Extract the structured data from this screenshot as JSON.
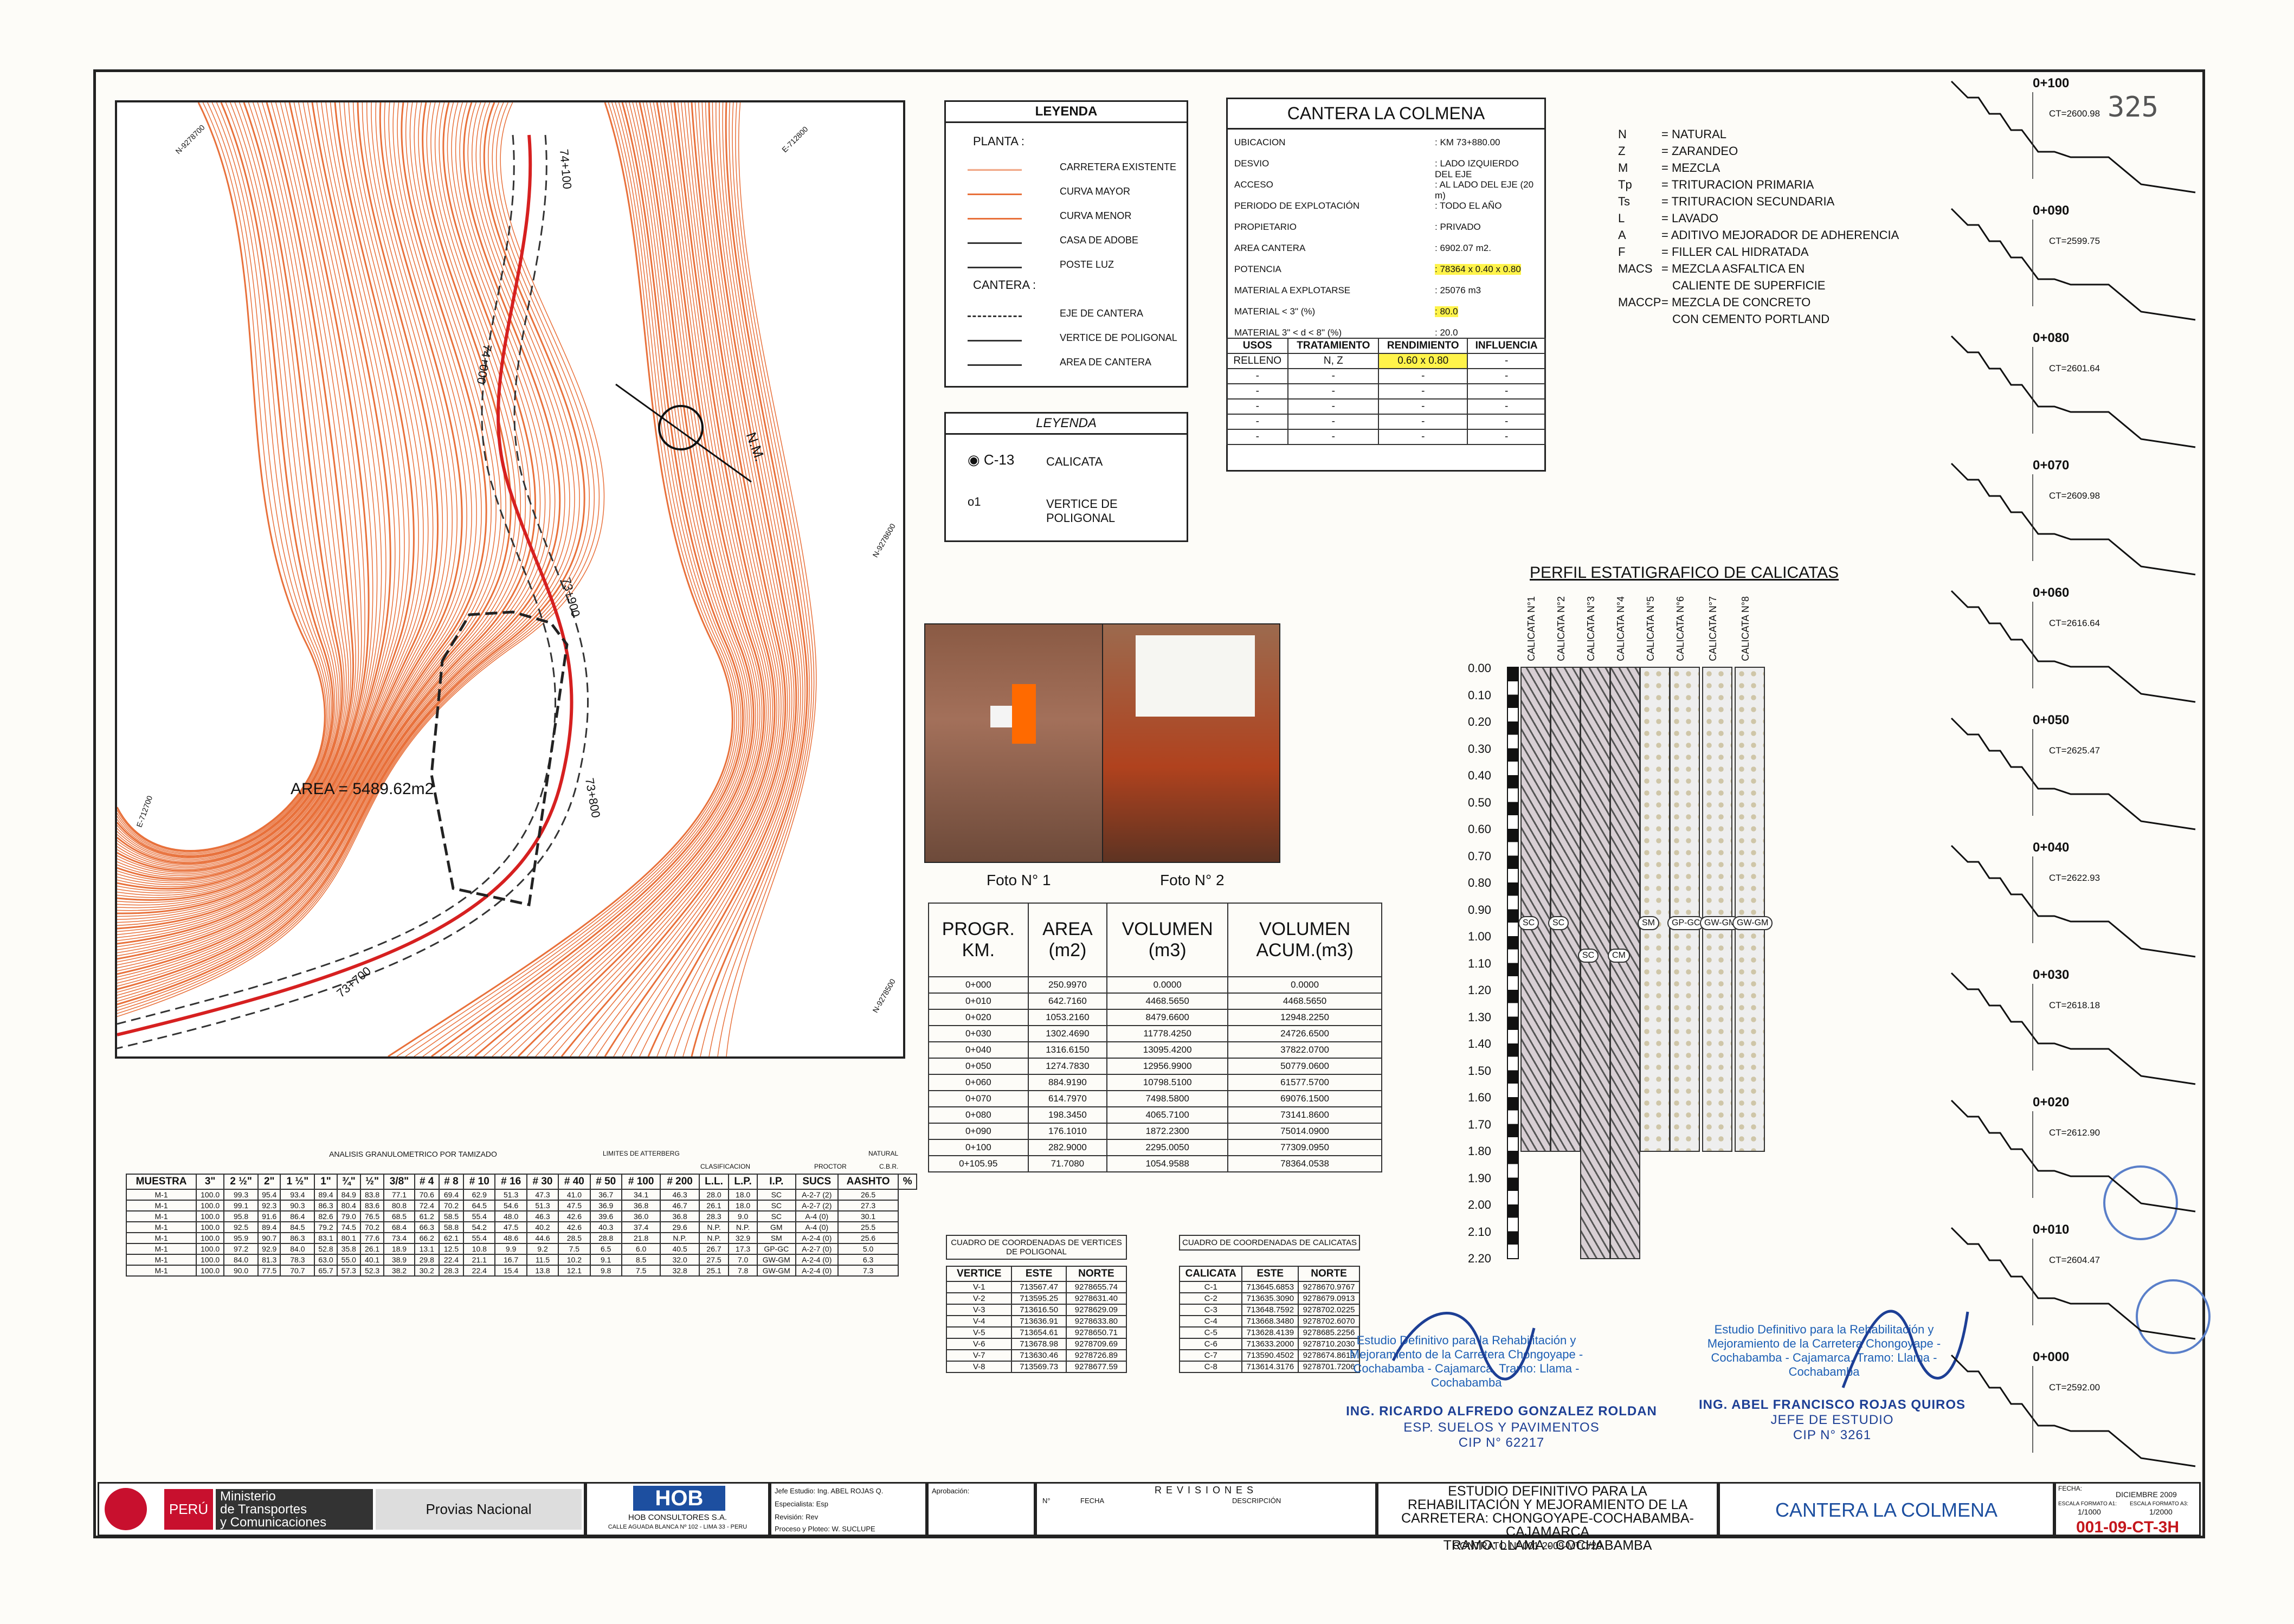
{
  "sheet": {
    "page_number": "325"
  },
  "map": {
    "area_label": "AREA = 5489.62m2",
    "north_label": "N.M.",
    "road_stations": [
      "74+100",
      "74+000",
      "73+900",
      "73+800",
      "73+700"
    ],
    "grid_labels": [
      "N-9278700",
      "E-712800",
      "N-9278600",
      "E-712700",
      "N-9278500"
    ]
  },
  "legend1": {
    "title": "LEYENDA",
    "planta_label": "PLANTA :",
    "cantera_label": "CANTERA :",
    "items": [
      {
        "label": "CARRETERA EXISTENTE",
        "icon": "road-line-icon"
      },
      {
        "label": "CURVA MAYOR",
        "icon": "major-contour-icon"
      },
      {
        "label": "CURVA MENOR",
        "icon": "minor-contour-icon"
      },
      {
        "label": "CASA DE ADOBE",
        "icon": "adobe-house-icon"
      },
      {
        "label": "POSTE LUZ",
        "icon": "light-pole-icon"
      },
      {
        "label": "EJE DE CANTERA",
        "icon": "quarry-axis-icon"
      },
      {
        "label": "VERTICE DE POLIGONAL",
        "icon": "polygon-vertex-icon"
      },
      {
        "label": "AREA DE CANTERA",
        "icon": "quarry-area-icon"
      }
    ]
  },
  "legend2": {
    "title": "LEYENDA",
    "items": [
      {
        "symbol": "C-13",
        "label": "CALICATA"
      },
      {
        "symbol": "o1",
        "label": "VERTICE DE POLIGONAL"
      }
    ]
  },
  "cantera": {
    "title": "CANTERA LA COLMENA",
    "rows": [
      {
        "k": "UBICACION",
        "v": ": KM 73+880.00",
        "hl": false
      },
      {
        "k": "DESVIO",
        "v": ": LADO IZQUIERDO DEL EJE",
        "hl": false
      },
      {
        "k": "ACCESO",
        "v": ": AL LADO DEL EJE (20 m)",
        "hl": false
      },
      {
        "k": "PERIODO DE EXPLOTACIÓN",
        "v": ": TODO EL AÑO",
        "hl": false
      },
      {
        "k": "PROPIETARIO",
        "v": ": PRIVADO",
        "hl": false
      },
      {
        "k": "AREA CANTERA",
        "v": ": 6902.07 m2.",
        "hl": false
      },
      {
        "k": "POTENCIA",
        "v": ": 78364 x 0.40 x 0.80",
        "hl": true
      },
      {
        "k": "MATERIAL A EXPLOTARSE",
        "v": ": 25076 m3",
        "hl": false
      },
      {
        "k": "MATERIAL < 3\" (%)",
        "v": ": 80.0",
        "hl": true
      },
      {
        "k": "MATERIAL 3\" < d < 8\" (%)",
        "v": ": 20.0",
        "hl": false
      }
    ],
    "uses_header": [
      "USOS",
      "TRATAMIENTO",
      "RENDIMIENTO",
      "INFLUENCIA"
    ],
    "uses_rows": [
      [
        "RELLENO",
        "N, Z",
        "0.60 x 0.80",
        "-"
      ],
      [
        "-",
        "-",
        "-",
        "-"
      ],
      [
        "-",
        "-",
        "-",
        "-"
      ],
      [
        "-",
        "-",
        "-",
        "-"
      ],
      [
        "-",
        "-",
        "-",
        "-"
      ],
      [
        "-",
        "-",
        "-",
        "-"
      ]
    ]
  },
  "abbreviations": [
    {
      "k": "N",
      "v": "= NATURAL"
    },
    {
      "k": "Z",
      "v": "= ZARANDEO"
    },
    {
      "k": "M",
      "v": "= MEZCLA"
    },
    {
      "k": "Tp",
      "v": "= TRITURACION PRIMARIA"
    },
    {
      "k": "Ts",
      "v": "= TRITURACION SECUNDARIA"
    },
    {
      "k": "L",
      "v": "= LAVADO"
    },
    {
      "k": "A",
      "v": "= ADITIVO MEJORADOR DE ADHERENCIA"
    },
    {
      "k": "F",
      "v": "= FILLER CAL HIDRATADA"
    },
    {
      "k": "MACS",
      "v": "= MEZCLA ASFALTICA EN"
    },
    {
      "k": "",
      "v": "CALIENTE DE SUPERFICIE"
    },
    {
      "k": "MACCP",
      "v": "= MEZCLA DE CONCRETO"
    },
    {
      "k": "",
      "v": "CON CEMENTO PORTLAND"
    }
  ],
  "photos": {
    "foto1": "Foto N° 1",
    "foto2": "Foto N° 2"
  },
  "volumes": {
    "header": [
      "PROGR. KM.",
      "AREA (m2)",
      "VOLUMEN (m3)",
      "VOLUMEN ACUM.(m3)"
    ],
    "rows": [
      [
        "0+000",
        "250.9970",
        "0.0000",
        "0.0000"
      ],
      [
        "0+010",
        "642.7160",
        "4468.5650",
        "4468.5650"
      ],
      [
        "0+020",
        "1053.2160",
        "8479.6600",
        "12948.2250"
      ],
      [
        "0+030",
        "1302.4690",
        "11778.4250",
        "24726.6500"
      ],
      [
        "0+040",
        "1316.6150",
        "13095.4200",
        "37822.0700"
      ],
      [
        "0+050",
        "1274.7830",
        "12956.9900",
        "50779.0600"
      ],
      [
        "0+060",
        "884.9190",
        "10798.5100",
        "61577.5700"
      ],
      [
        "0+070",
        "614.7970",
        "7498.5800",
        "69076.1500"
      ],
      [
        "0+080",
        "198.3450",
        "4065.7100",
        "73141.8600"
      ],
      [
        "0+090",
        "176.1010",
        "1872.2300",
        "75014.0900"
      ],
      [
        "0+100",
        "282.9000",
        "2295.0050",
        "77309.0950"
      ],
      [
        "0+105.95",
        "71.7080",
        "1054.9588",
        "78364.0538"
      ]
    ]
  },
  "profile": {
    "title": "PERFIL ESTATIGRAFICO DE CALICATAS",
    "calicatas": [
      "CALICATA N°1",
      "CALICATA N°2",
      "CALICATA N°3",
      "CALICATA N°4",
      "CALICATA N°5",
      "CALICATA N°6",
      "CALICATA N°7",
      "CALICATA N°8"
    ],
    "depths": [
      "0.00",
      "0.10",
      "0.20",
      "0.30",
      "0.40",
      "0.50",
      "0.60",
      "0.70",
      "0.80",
      "0.90",
      "1.00",
      "1.10",
      "1.20",
      "1.30",
      "1.40",
      "1.50",
      "1.60",
      "1.70",
      "1.80",
      "1.90",
      "2.00",
      "2.10",
      "2.20"
    ],
    "soil_tags": [
      "SC",
      "SC",
      "SC",
      "CM",
      "SM",
      "GP-GC",
      "GW-GM",
      "GW-GM"
    ]
  },
  "vertices": {
    "title": "CUADRO DE COORDENADAS DE VERTICES DE POLIGONAL",
    "header": [
      "VERTICE",
      "ESTE",
      "NORTE"
    ],
    "rows": [
      [
        "V-1",
        "713567.47",
        "9278655.74"
      ],
      [
        "V-2",
        "713595.25",
        "9278631.40"
      ],
      [
        "V-3",
        "713616.50",
        "9278629.09"
      ],
      [
        "V-4",
        "713636.91",
        "9278633.80"
      ],
      [
        "V-5",
        "713654.61",
        "9278650.71"
      ],
      [
        "V-6",
        "713678.98",
        "9278709.69"
      ],
      [
        "V-7",
        "713630.46",
        "9278726.89"
      ],
      [
        "V-8",
        "713569.73",
        "9278677.59"
      ]
    ]
  },
  "calicatas_coords": {
    "title": "CUADRO DE COORDENADAS DE CALICATAS",
    "header": [
      "CALICATA",
      "ESTE",
      "NORTE"
    ],
    "rows": [
      [
        "C-1",
        "713645.6853",
        "9278670.9767"
      ],
      [
        "C-2",
        "713635.3090",
        "9278679.0913"
      ],
      [
        "C-3",
        "713648.7592",
        "9278702.0225"
      ],
      [
        "C-4",
        "713668.3480",
        "9278702.6070"
      ],
      [
        "C-5",
        "713628.4139",
        "9278685.2256"
      ],
      [
        "C-6",
        "713633.2000",
        "9278710.2030"
      ],
      [
        "C-7",
        "713590.4502",
        "9278674.8619"
      ],
      [
        "C-8",
        "713614.3176",
        "9278701.7206"
      ]
    ]
  },
  "lab": {
    "title": "ANALISIS GRANULOMETRICO POR TAMIZADO",
    "limits": "LIMITES DE ATTERBERG",
    "classification": "CLASIFICACION",
    "natural": "NATURAL",
    "proctor": "PROCTOR",
    "cbr": "C.B.R.",
    "sieve_header": [
      "3\"",
      "2 ½\"",
      "2\"",
      "1 ½\"",
      "1\"",
      "¾\"",
      "½\"",
      "3/8\"",
      "# 4",
      "# 8",
      "# 10",
      "# 16",
      "# 30",
      "# 40",
      "# 50",
      "# 100",
      "# 200"
    ],
    "rows": [
      [
        "M-1",
        "100.0",
        "99.3",
        "95.4",
        "93.4",
        "89.4",
        "84.9",
        "83.8",
        "77.1",
        "70.6",
        "69.4",
        "62.9",
        "51.3",
        "47.3",
        "41.0",
        "36.7",
        "34.1",
        "46.3",
        "28.0",
        "18.0",
        "SC",
        "A-2-7 (2)",
        "26.5"
      ],
      [
        "M-1",
        "100.0",
        "99.1",
        "92.3",
        "90.3",
        "86.3",
        "80.4",
        "83.6",
        "80.8",
        "72.4",
        "70.2",
        "64.5",
        "54.6",
        "51.3",
        "47.5",
        "36.9",
        "36.8",
        "46.7",
        "26.1",
        "18.0",
        "SC",
        "A-2-7 (2)",
        "27.3"
      ],
      [
        "M-1",
        "100.0",
        "95.8",
        "91.6",
        "86.4",
        "82.6",
        "79.0",
        "76.5",
        "68.5",
        "61.2",
        "58.5",
        "55.4",
        "48.0",
        "46.3",
        "42.6",
        "39.6",
        "36.0",
        "36.8",
        "28.3",
        "9.0",
        "SC",
        "A-4 (0)",
        "30.1"
      ],
      [
        "M-1",
        "100.0",
        "92.5",
        "89.4",
        "84.5",
        "79.2",
        "74.5",
        "70.2",
        "68.4",
        "66.3",
        "58.8",
        "54.2",
        "47.5",
        "40.2",
        "42.6",
        "40.3",
        "37.4",
        "29.6",
        "N.P.",
        "N.P.",
        "GM",
        "A-4 (0)",
        "25.5"
      ],
      [
        "M-1",
        "100.0",
        "95.9",
        "90.7",
        "86.3",
        "83.1",
        "80.1",
        "77.6",
        "73.4",
        "66.2",
        "62.1",
        "55.4",
        "48.6",
        "44.6",
        "28.5",
        "28.8",
        "21.8",
        "N.P.",
        "N.P.",
        "32.9",
        "SM",
        "A-2-4 (0)",
        "25.6"
      ],
      [
        "M-1",
        "100.0",
        "97.2",
        "92.9",
        "84.0",
        "52.8",
        "35.8",
        "26.1",
        "18.9",
        "13.1",
        "12.5",
        "10.8",
        "9.9",
        "9.2",
        "7.5",
        "6.5",
        "6.0",
        "40.5",
        "26.7",
        "17.3",
        "GP-GC",
        "A-2-7 (0)",
        "5.0"
      ],
      [
        "M-1",
        "100.0",
        "84.0",
        "81.3",
        "78.3",
        "63.0",
        "55.0",
        "40.1",
        "38.9",
        "29.8",
        "22.4",
        "21.1",
        "16.7",
        "11.5",
        "10.2",
        "9.1",
        "8.5",
        "32.0",
        "27.5",
        "7.0",
        "GW-GM",
        "A-2-4 (0)",
        "6.3"
      ],
      [
        "M-1",
        "100.0",
        "90.0",
        "77.5",
        "70.7",
        "65.7",
        "57.3",
        "52.3",
        "38.2",
        "30.2",
        "28.3",
        "22.4",
        "15.4",
        "13.8",
        "12.1",
        "9.8",
        "7.5",
        "32.8",
        "25.1",
        "7.8",
        "GW-GM",
        "A-2-4 (0)",
        "7.3"
      ]
    ]
  },
  "signatures": {
    "left_note": "Estudio Definitivo para la Rehabilitación y Mejoramiento de la Carretera Chongoyape - Cochabamba - Cajamarca. Tramo: Llama - Cochabamba",
    "left_name": "ING. RICARDO ALFREDO GONZALEZ ROLDAN",
    "left_role": "ESP. SUELOS Y PAVIMENTOS",
    "left_cip": "CIP N° 62217",
    "right_note": "Estudio Definitivo para la Rehabilitación y Mejoramiento de la Carretera Chongoyape - Cochabamba - Cajamarca. Tramo: Llama - Cochabamba",
    "right_name": "ING. ABEL FRANCISCO ROJAS QUIROS",
    "right_role": "JEFE DE ESTUDIO",
    "right_cip": "CIP N° 3261"
  },
  "cross_sections": [
    {
      "station": "0+100",
      "ct": "CT=2600.98"
    },
    {
      "station": "0+090",
      "ct": "CT=2599.75"
    },
    {
      "station": "0+080",
      "ct": "CT=2601.64"
    },
    {
      "station": "0+070",
      "ct": "CT=2609.98"
    },
    {
      "station": "0+060",
      "ct": "CT=2616.64"
    },
    {
      "station": "0+050",
      "ct": "CT=2625.47"
    },
    {
      "station": "0+040",
      "ct": "CT=2622.93"
    },
    {
      "station": "0+030",
      "ct": "CT=2618.18"
    },
    {
      "station": "0+020",
      "ct": "CT=2612.90"
    },
    {
      "station": "0+010",
      "ct": "CT=2604.47"
    },
    {
      "station": "0+000",
      "ct": "CT=2592.00"
    }
  ],
  "title_block": {
    "peru": "PERÚ",
    "ministry_line1": "Ministerio",
    "ministry_line2": "de Transportes",
    "ministry_line3": "y Comunicaciones",
    "provias": "Provias Nacional",
    "company": "HOB",
    "company_sub": "HOB CONSULTORES S.A.",
    "company_addr": "CALLE AGUADA BLANCA Nº 102 - LIMA 33 - PERU",
    "jefe_label": "Jefe Estudio:",
    "jefe": "Ing. ABEL ROJAS Q.",
    "esp_label": "Especialista:",
    "esp": "Esp",
    "rev_label": "Revisión:",
    "rev": "Rev",
    "proc_label": "Proceso y Ploteo:",
    "proc": "W. SUCLUPE",
    "aprob_label": "Aprobación:",
    "revisiones": "REVISIONES",
    "rev_cols": [
      "N°",
      "FECHA",
      "DESCRIPCIÓN"
    ],
    "project_lines": [
      "ESTUDIO DEFINITIVO PARA LA",
      "REHABILITACIÓN Y MEJORAMIENTO DE LA",
      "CARRETERA: CHONGOYAPE-COCHABAMBA-CAJAMARCA",
      "TRAMO: LLAMA - COCHABAMBA",
      "CONTRATO Nº 001-2009-MTC/20"
    ],
    "sheet_title": "CANTERA LA COLMENA",
    "fecha_label": "FECHA:",
    "fecha": "DICIEMBRE 2009",
    "escala_a1_label": "ESCALA FORMATO A1:",
    "escala_a1": "1/1000",
    "escala_a3_label": "ESCALA FORMATO A3:",
    "escala_a3": "1/2000",
    "code": "001-09-CT-3H"
  },
  "colors": {
    "contour": "#e8703a",
    "road": "#d62020",
    "title_blue": "#1d4fa0",
    "code_red": "#c4171d",
    "highlight": "#fff34a",
    "peru_red": "#c8102e"
  }
}
